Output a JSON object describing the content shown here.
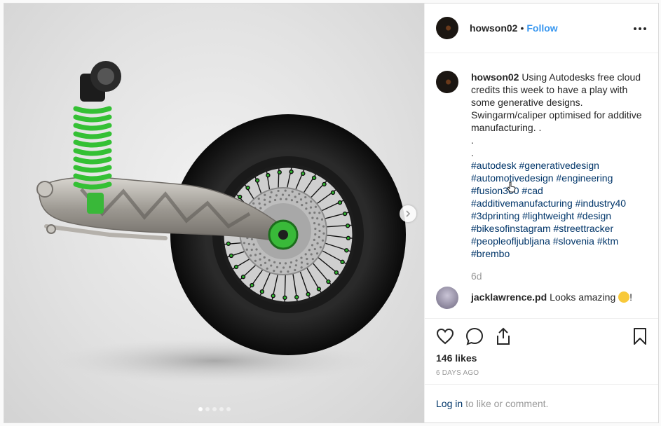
{
  "post": {
    "username": "howson02",
    "separator": "•",
    "follow_label": "Follow",
    "caption_text": "Using Autodesks free cloud credits this week to have a play with some generative designs. Swingarm/caliper optimised for additive manufacturing. .",
    "caption_dots": [
      ".",
      "."
    ],
    "hashtags": [
      "#autodesk",
      "#generativedesign",
      "#automotivedesign",
      "#engineering",
      "#fusion360",
      "#cad",
      "#additivemanufacturing",
      "#industry40",
      "#3dprinting",
      "#lightweight",
      "#design",
      "#bikesofinstagram",
      "#streettracker",
      "#peopleofljubljana",
      "#slovenia",
      "#ktm",
      "#brembo"
    ],
    "time_ago": "6d",
    "comment": {
      "username": "jacklawrence.pd",
      "text": "Looks amazing",
      "suffix": "!"
    },
    "likes": "146 likes",
    "date": "6 DAYS AGO",
    "login_link": "Log in",
    "login_text": "to like or comment."
  },
  "carousel": {
    "slides": 5,
    "active": 1
  },
  "colors": {
    "accent": "#3897f0",
    "link": "#003569",
    "muted": "#999999",
    "spring": "#2fb52f"
  },
  "icons": [
    "more-icon",
    "heart-icon",
    "comment-icon",
    "share-icon",
    "bookmark-icon",
    "chevron-right-icon",
    "pointer-cursor-icon"
  ]
}
